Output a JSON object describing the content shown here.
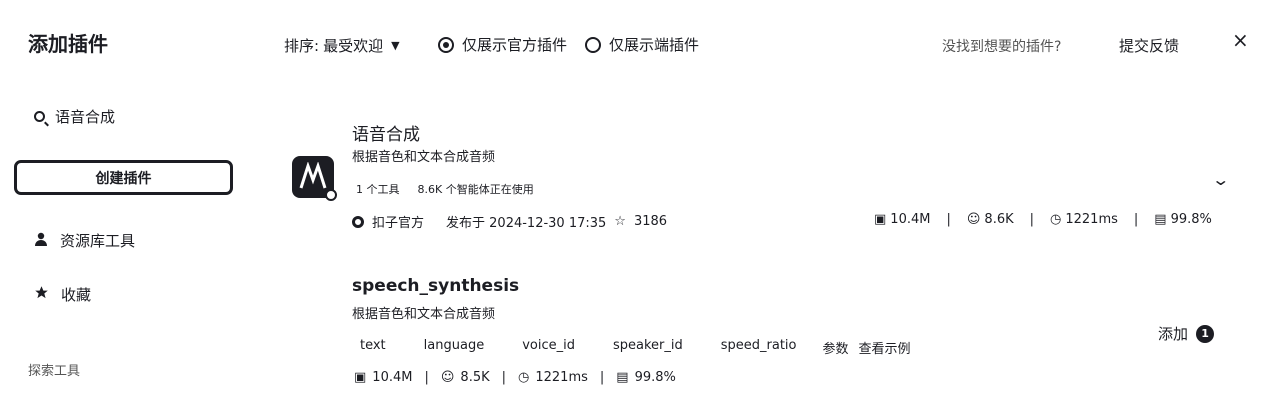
{
  "header": {
    "title": "添加插件",
    "close_icon": "×"
  },
  "filters": {
    "sort_label": "排序:",
    "sort_value": "最受欢迎",
    "radio_official": "仅展示官方插件",
    "radio_endpoint": "仅展示端插件",
    "official_selected": true,
    "not_found_hint": "没找到想要的插件?",
    "feedback_link": "提交反馈"
  },
  "sidebar": {
    "search_label": "语音合成",
    "create_button": "创建插件",
    "items": [
      {
        "label": "资源库工具",
        "icon": "person-icon"
      },
      {
        "label": "收藏",
        "icon": "star-icon"
      }
    ],
    "explore_heading": "探索工具"
  },
  "plugin": {
    "name": "语音合成",
    "description": "根据音色和文本合成音频",
    "tags": [
      "1 个工具",
      "8.6K 个智能体正在使用"
    ],
    "publisher": "扣子官方",
    "published": "发布于 2024-12-30 17:35",
    "favorites": "3186",
    "stats": {
      "calls": "10.4M",
      "bots": "8.6K",
      "latency": "1221ms",
      "success": "99.8%"
    }
  },
  "tool": {
    "name": "speech_synthesis",
    "description": "根据音色和文本合成音频",
    "params": [
      "text",
      "language",
      "voice_id",
      "speaker_id",
      "speed_ratio"
    ],
    "params_label": "参数",
    "example_link": "查看示例",
    "stats": {
      "calls": "10.4M",
      "bots": "8.5K",
      "latency": "1221ms",
      "success": "99.8%"
    },
    "add_label": "添加",
    "add_count": "1"
  }
}
